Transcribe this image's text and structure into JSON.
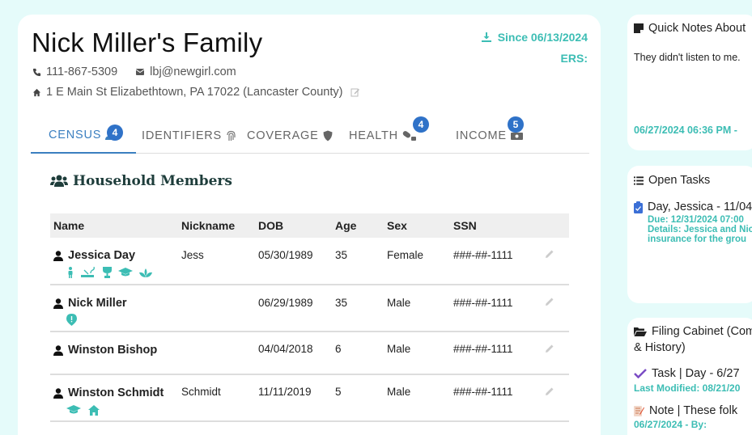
{
  "family": {
    "title": "Nick Miller's Family",
    "phone": "111-867-5309",
    "email": "lbj@newgirl.com",
    "address": "1 E Main St Elizabethtown, PA 17022 (Lancaster County)",
    "since": "Since 06/13/2024",
    "ers": "ERS:"
  },
  "tabs": [
    {
      "label": "CENSUS",
      "badge": "4",
      "active": true
    },
    {
      "label": "IDENTIFIERS",
      "badge": ""
    },
    {
      "label": "COVERAGE",
      "badge": ""
    },
    {
      "label": "HEALTH",
      "badge": "4"
    },
    {
      "label": "INCOME",
      "badge": "5"
    }
  ],
  "household": {
    "title": "Household Members",
    "columns": [
      "Name",
      "Nickname",
      "DOB",
      "Age",
      "Sex",
      "SSN"
    ],
    "rows": [
      {
        "name": "Jessica Day",
        "nickname": "Jess",
        "dob": "05/30/1989",
        "age": "35",
        "sex": "Female",
        "ssn": "###-##-1111",
        "flags": [
          "person-standing-icon",
          "smoking-icon",
          "award-icon",
          "graduation-cap-icon",
          "lotus-icon"
        ]
      },
      {
        "name": "Nick Miller",
        "nickname": "",
        "dob": "06/29/1989",
        "age": "35",
        "sex": "Male",
        "ssn": "###-##-1111",
        "flags": [
          "alert-pin-icon"
        ]
      },
      {
        "name": "Winston Bishop",
        "nickname": "",
        "dob": "04/04/2018",
        "age": "6",
        "sex": "Male",
        "ssn": "###-##-1111",
        "flags": []
      },
      {
        "name": "Winston Schmidt",
        "nickname": "Schmidt",
        "dob": "11/11/2019",
        "age": "5",
        "sex": "Male",
        "ssn": "###-##-1111",
        "flags": [
          "graduation-cap-icon",
          "home-icon"
        ]
      }
    ]
  },
  "quick_notes": {
    "title": "Quick Notes About",
    "text": "They didn't listen to me.",
    "timestamp": "06/27/2024 06:36 PM -"
  },
  "open_tasks": {
    "title": "Open Tasks",
    "task": "Day, Jessica - 11/04",
    "due": "Due: 12/31/2024 07:00",
    "details": "Details: Jessica and Nic",
    "details2": "insurance for the grou"
  },
  "filing_cabinet": {
    "title": "Filing Cabinet (Com",
    "title2": "& History)",
    "item1": "Task | Day - 6/27",
    "item1_meta": "Last Modified: 08/21/20",
    "item2": "Note | These folk",
    "item2_meta": "06/27/2024 - By:"
  },
  "colors": {
    "accent": "#3cbdb4",
    "tab_active": "#3b7fc0",
    "badge": "#2f72c8",
    "background": "#e5fbfa"
  }
}
